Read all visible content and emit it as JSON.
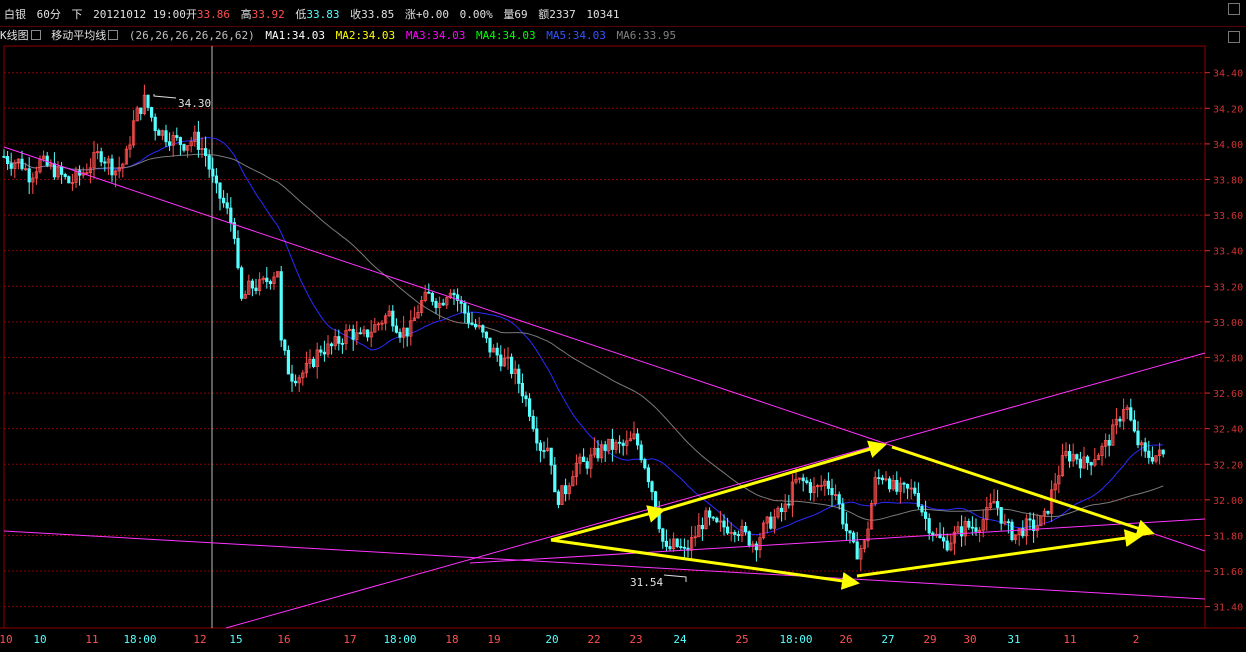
{
  "header": {
    "symbol": "白银",
    "period": "60分",
    "direction": "下",
    "datetime": "20121012 19:00",
    "open_label": "开",
    "open": "33.86",
    "high_label": "高",
    "high": "33.92",
    "low_label": "低",
    "low": "33.83",
    "close_label": "收",
    "close": "33.85",
    "change_label": "涨",
    "change": "+0.00",
    "pct": "0.00%",
    "vol_label": "量",
    "vol": "69",
    "amt_label": "额",
    "amt": "2337",
    "extra": "10341"
  },
  "indicators": {
    "kline_label": "K线图",
    "ma_label": "移动平均线",
    "params": "(26,26,26,26,26,62)",
    "items": [
      {
        "label": "MA1:34.03",
        "color": "#ffffff"
      },
      {
        "label": "MA2:34.03",
        "color": "#ffff00"
      },
      {
        "label": "MA3:34.03",
        "color": "#ff00ff"
      },
      {
        "label": "MA4:34.03",
        "color": "#00ff00"
      },
      {
        "label": "MA5:34.03",
        "color": "#3355ff"
      },
      {
        "label": "MA6:33.95",
        "color": "#808080"
      }
    ]
  },
  "colors": {
    "up": "#ff5050",
    "down": "#55ffff",
    "grid": "#8b0000",
    "axis_text": "#cc3333",
    "trend": "#ff33ff",
    "arrow": "#ffff00",
    "ma_blue": "#2a2aff",
    "ma_gray": "#7a7a7a"
  },
  "chart_data": {
    "type": "candlestick",
    "title": "白银 60分",
    "y_ticks": [
      "34.40",
      "34.20",
      "34.00",
      "33.80",
      "33.60",
      "33.40",
      "33.20",
      "33.00",
      "32.80",
      "32.60",
      "32.40",
      "32.20",
      "32.00",
      "31.80",
      "31.60",
      "31.40"
    ],
    "ylim": [
      31.28,
      34.55
    ],
    "x_labels": [
      "10",
      "10",
      "11",
      "18:00",
      "12",
      "15",
      "16",
      "17",
      "18:00",
      "18",
      "19",
      "20",
      "22",
      "23",
      "24",
      "25",
      "18:00",
      "26",
      "27",
      "29",
      "30",
      "31",
      "11",
      "2"
    ],
    "x_label_colors": [
      "up",
      "down",
      "up",
      "down",
      "up",
      "down",
      "up",
      "up",
      "down",
      "up",
      "up",
      "down",
      "up",
      "up",
      "down",
      "up",
      "down",
      "up",
      "down",
      "up",
      "up",
      "down",
      "up",
      "up"
    ],
    "annotations": [
      {
        "text": "34.30",
        "value": 34.3
      },
      {
        "text": "31.54",
        "value": 31.54
      }
    ],
    "price_path": [
      [
        0,
        33.95
      ],
      [
        10,
        33.9
      ],
      [
        20,
        33.9
      ],
      [
        30,
        33.82
      ],
      [
        40,
        33.9
      ],
      [
        55,
        33.85
      ],
      [
        70,
        33.78
      ],
      [
        85,
        33.85
      ],
      [
        100,
        33.95
      ],
      [
        115,
        33.85
      ],
      [
        125,
        33.9
      ],
      [
        135,
        34.15
      ],
      [
        145,
        34.25
      ],
      [
        155,
        34.1
      ],
      [
        165,
        34.05
      ],
      [
        175,
        34.02
      ],
      [
        185,
        34.0
      ],
      [
        195,
        34.03
      ],
      [
        205,
        33.95
      ],
      [
        215,
        33.75
      ],
      [
        225,
        33.65
      ],
      [
        235,
        33.5
      ],
      [
        240,
        33.1
      ],
      [
        250,
        33.2
      ],
      [
        260,
        33.2
      ],
      [
        270,
        33.25
      ],
      [
        278,
        33.3
      ],
      [
        280,
        32.9
      ],
      [
        290,
        32.7
      ],
      [
        300,
        32.7
      ],
      [
        310,
        32.75
      ],
      [
        320,
        32.85
      ],
      [
        330,
        32.85
      ],
      [
        340,
        32.9
      ],
      [
        350,
        32.95
      ],
      [
        360,
        32.9
      ],
      [
        370,
        32.95
      ],
      [
        380,
        33.0
      ],
      [
        390,
        33.05
      ],
      [
        400,
        32.95
      ],
      [
        410,
        32.95
      ],
      [
        420,
        33.1
      ],
      [
        430,
        33.15
      ],
      [
        440,
        33.1
      ],
      [
        450,
        33.2
      ],
      [
        460,
        33.1
      ],
      [
        470,
        33.0
      ],
      [
        480,
        32.95
      ],
      [
        490,
        32.85
      ],
      [
        500,
        32.8
      ],
      [
        510,
        32.75
      ],
      [
        520,
        32.65
      ],
      [
        530,
        32.5
      ],
      [
        540,
        32.3
      ],
      [
        550,
        32.3
      ],
      [
        555,
        32.0
      ],
      [
        565,
        32.05
      ],
      [
        575,
        32.2
      ],
      [
        585,
        32.2
      ],
      [
        595,
        32.25
      ],
      [
        605,
        32.3
      ],
      [
        615,
        32.3
      ],
      [
        625,
        32.3
      ],
      [
        635,
        32.35
      ],
      [
        645,
        32.2
      ],
      [
        655,
        32.0
      ],
      [
        665,
        31.7
      ],
      [
        675,
        31.75
      ],
      [
        685,
        31.7
      ],
      [
        695,
        31.8
      ],
      [
        705,
        31.9
      ],
      [
        715,
        31.85
      ],
      [
        725,
        31.85
      ],
      [
        735,
        31.85
      ],
      [
        745,
        31.8
      ],
      [
        755,
        31.75
      ],
      [
        765,
        31.85
      ],
      [
        775,
        31.9
      ],
      [
        785,
        31.95
      ],
      [
        795,
        32.1
      ],
      [
        805,
        32.1
      ],
      [
        815,
        32.05
      ],
      [
        825,
        32.1
      ],
      [
        835,
        32.05
      ],
      [
        845,
        31.85
      ],
      [
        855,
        31.7
      ],
      [
        865,
        31.75
      ],
      [
        875,
        32.1
      ],
      [
        885,
        32.15
      ],
      [
        895,
        32.05
      ],
      [
        905,
        32.05
      ],
      [
        915,
        32.05
      ],
      [
        925,
        31.9
      ],
      [
        935,
        31.8
      ],
      [
        945,
        31.75
      ],
      [
        955,
        31.8
      ],
      [
        965,
        31.85
      ],
      [
        975,
        31.85
      ],
      [
        985,
        31.9
      ],
      [
        995,
        32.0
      ],
      [
        1005,
        31.85
      ],
      [
        1015,
        31.8
      ],
      [
        1025,
        31.85
      ],
      [
        1035,
        31.85
      ],
      [
        1045,
        31.9
      ],
      [
        1055,
        32.1
      ],
      [
        1065,
        32.25
      ],
      [
        1075,
        32.25
      ],
      [
        1085,
        32.2
      ],
      [
        1095,
        32.25
      ],
      [
        1105,
        32.3
      ],
      [
        1115,
        32.4
      ],
      [
        1125,
        32.55
      ],
      [
        1135,
        32.35
      ],
      [
        1145,
        32.25
      ],
      [
        1155,
        32.25
      ],
      [
        1165,
        32.25
      ]
    ]
  }
}
